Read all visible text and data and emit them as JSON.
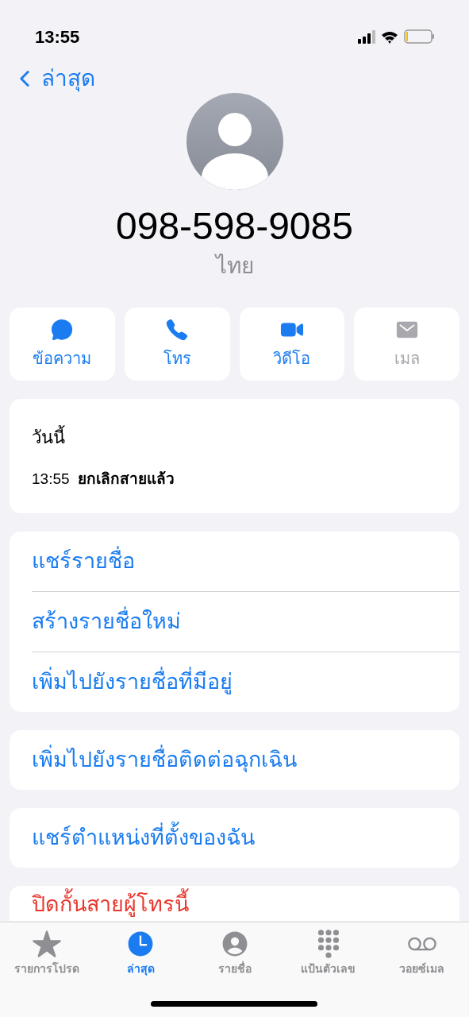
{
  "status_bar": {
    "time": "13:55"
  },
  "nav": {
    "back_label": "ล่าสุด"
  },
  "contact": {
    "number": "098-598-9085",
    "label": "ไทย"
  },
  "actions": [
    {
      "kind": "message",
      "label": "ข้อความ",
      "disabled": false
    },
    {
      "kind": "call",
      "label": "โทร",
      "disabled": false
    },
    {
      "kind": "video",
      "label": "วิดีโอ",
      "disabled": false
    },
    {
      "kind": "mail",
      "label": "เมล",
      "disabled": true
    }
  ],
  "history": {
    "heading": "วันนี้",
    "entries": [
      {
        "time": "13:55",
        "status": "ยกเลิกสายแล้ว"
      }
    ]
  },
  "option_groups": [
    {
      "items": [
        {
          "label": "แชร์รายชื่อ",
          "destructive": false
        },
        {
          "label": "สร้างรายชื่อใหม่",
          "destructive": false
        },
        {
          "label": "เพิ่มไปยังรายชื่อที่มีอยู่",
          "destructive": false
        }
      ]
    },
    {
      "items": [
        {
          "label": "เพิ่มไปยังรายชื่อติดต่อฉุกเฉิน",
          "destructive": false
        }
      ]
    },
    {
      "items": [
        {
          "label": "แชร์ตำแหน่งที่ตั้งของฉัน",
          "destructive": false
        }
      ]
    },
    {
      "items": [
        {
          "label": "ปิดกั้นสายผู้โทรนี้",
          "destructive": true
        }
      ]
    }
  ],
  "tab_bar": [
    {
      "kind": "favorites",
      "label": "รายการโปรด",
      "selected": false
    },
    {
      "kind": "recents",
      "label": "ล่าสุด",
      "selected": true
    },
    {
      "kind": "contacts",
      "label": "รายชื่อ",
      "selected": false
    },
    {
      "kind": "keypad",
      "label": "แป้นตัวเลข",
      "selected": false
    },
    {
      "kind": "voicemail",
      "label": "วอยซ์เมล",
      "selected": false
    }
  ]
}
